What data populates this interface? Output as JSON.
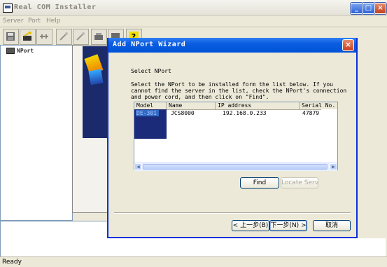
{
  "window": {
    "title": "Real COM Installer"
  },
  "menu": {
    "items": [
      "Server",
      "Port",
      "Help"
    ]
  },
  "toolbar": {
    "icons": [
      "disk-icon",
      "wizard-add-icon",
      "connect-icon",
      "wand-icon",
      "wand2-icon",
      "server-icon",
      "monitor-icon",
      "help-icon"
    ]
  },
  "tree": {
    "root": "NPort"
  },
  "dialog": {
    "title": "Add NPort Wizard",
    "heading": "Select NPort",
    "instructions": "Select the NPort to be installed form the list below. If you\ncannot find the server in the list, check the NPort's connection\nand power cord, and then click on \"Find\".",
    "list": {
      "columns": [
        "Model",
        "Name",
        "IP address",
        "Serial No."
      ],
      "rows": [
        {
          "model": "DE-301",
          "name": "JCS8000",
          "ip": "192.168.0.233",
          "serial": "47879"
        }
      ]
    },
    "buttons": {
      "find": "Find",
      "locate": "Locate Server",
      "back": "< 上一步(B)",
      "next": "下一步(N) >",
      "cancel": "取消"
    }
  },
  "status": {
    "text": "Ready"
  }
}
